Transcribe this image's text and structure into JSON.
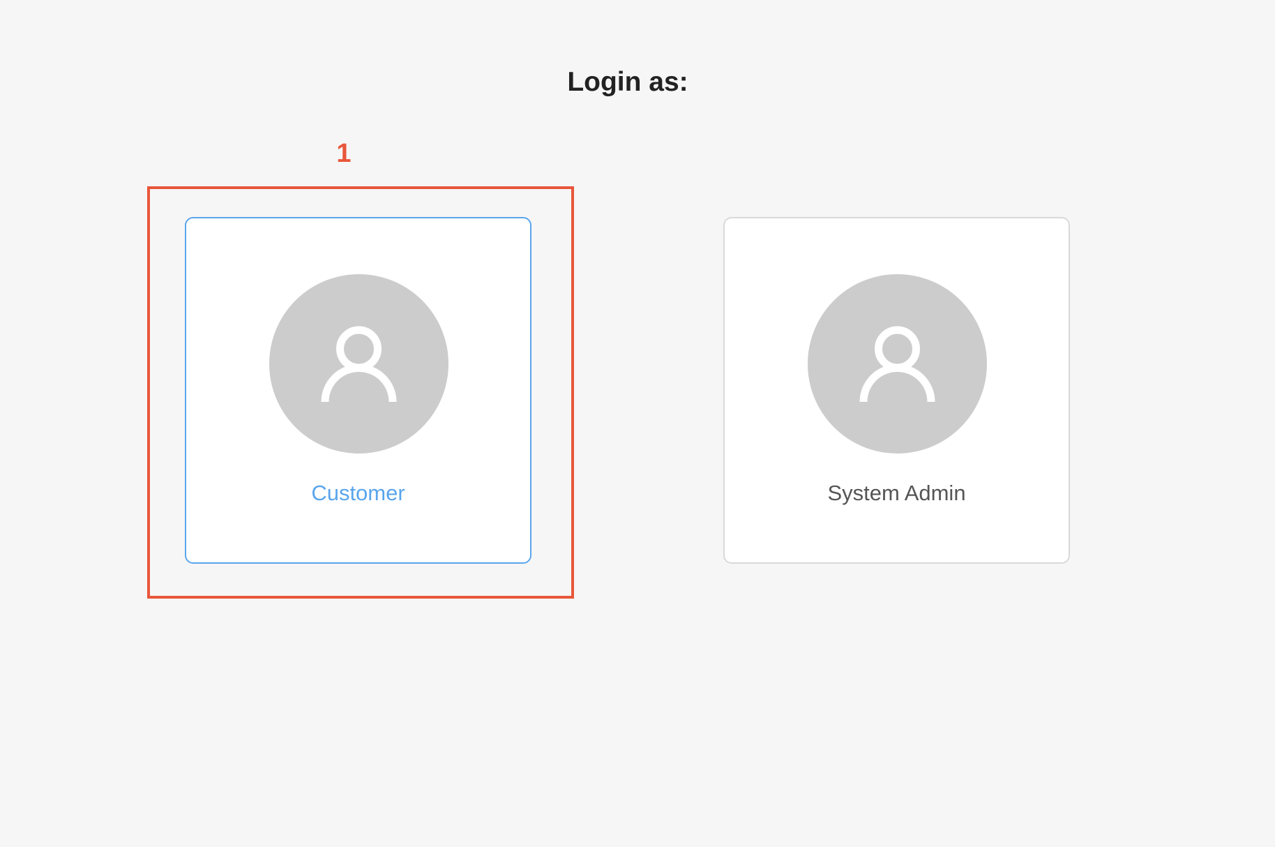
{
  "page": {
    "title": "Login as:"
  },
  "roles": [
    {
      "label": "Customer",
      "icon": "user-icon",
      "selected": true
    },
    {
      "label": "System Admin",
      "icon": "user-icon",
      "selected": false
    }
  ],
  "annotation": {
    "number": "1"
  },
  "colors": {
    "background": "#f6f6f6",
    "accent": "#5aa5ec",
    "highlight": "#e8573a",
    "avatar": "#cccccc"
  }
}
